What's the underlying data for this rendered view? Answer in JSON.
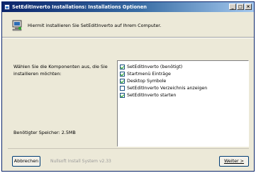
{
  "window": {
    "title": "SetEditInverto Installations: Installations Optionen",
    "controls": {
      "minimize": "_",
      "maximize": "□",
      "close": "×"
    }
  },
  "banner": {
    "text": "Hiermit installieren Sie SetEditInverto auf Ihrem Computer.",
    "icon": "setup-computer-icon"
  },
  "components": {
    "prompt": "Wählen Sie die Komponenten aus, die Sie installieren möchten:",
    "items": [
      {
        "label": "SetEditInverto (benötigt)",
        "checked": true
      },
      {
        "label": "Startmenü Einträge",
        "checked": true
      },
      {
        "label": "Desktop Symbole",
        "checked": true
      },
      {
        "label": "SetEditInverto Verzeichnis anzeigen",
        "checked": false
      },
      {
        "label": "SetEditInverto starten",
        "checked": true
      }
    ]
  },
  "space_required": "Benötigter Speicher: 2.5MB",
  "footer": {
    "cancel_label": "Abbrechen",
    "brand": "Nullsoft Install System v2.33",
    "next_label": "Weiter >"
  }
}
